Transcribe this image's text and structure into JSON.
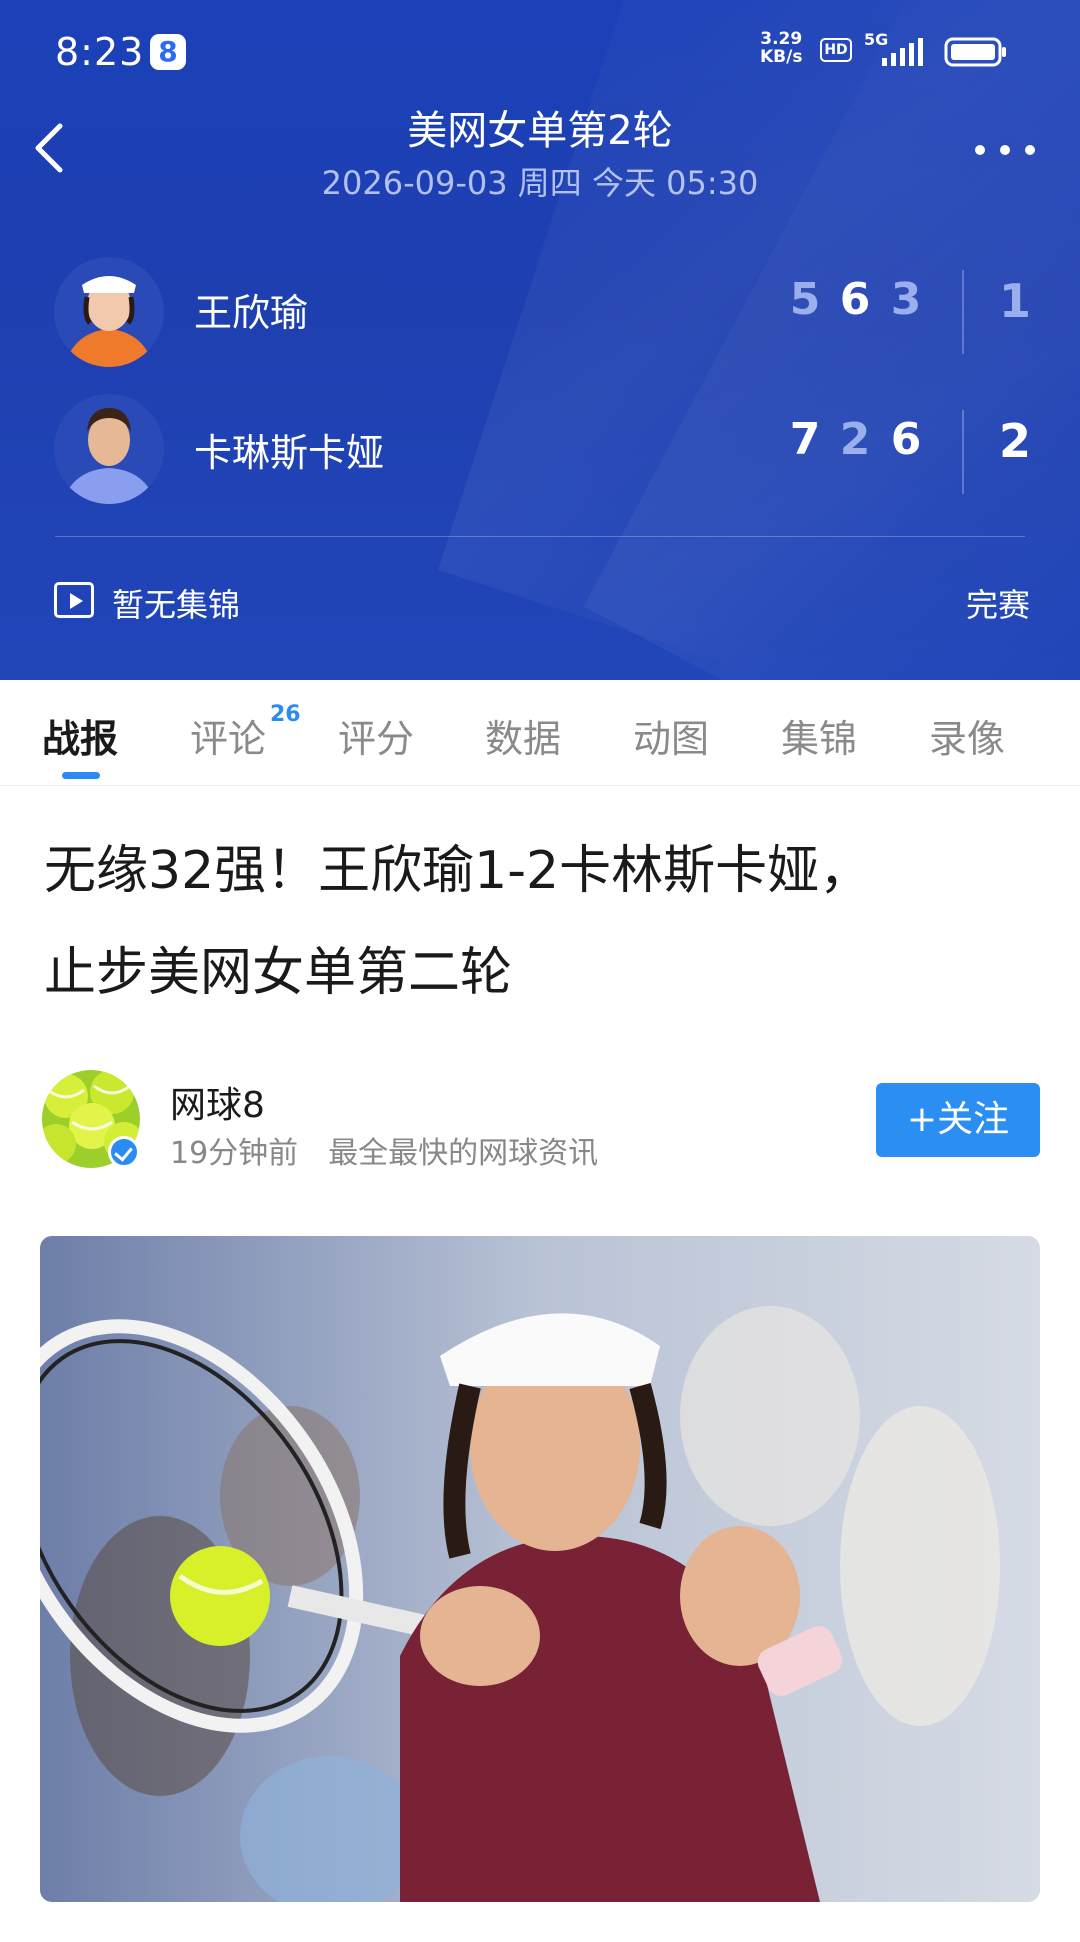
{
  "status_bar": {
    "time": "8:23",
    "app_badge": "8",
    "speed_value": "3.29",
    "speed_unit": "KB/s",
    "hd": "HD",
    "network": "5G"
  },
  "header": {
    "title": "美网女单第2轮",
    "datetime": "2026-09-03 周四 今天 05:30"
  },
  "players": [
    {
      "name": "王欣瑜",
      "sets": [
        "5",
        "6",
        "3"
      ],
      "sets_won": "1"
    },
    {
      "name": "卡琳斯卡娅",
      "sets": [
        "7",
        "2",
        "6"
      ],
      "sets_won": "2"
    }
  ],
  "highlights_label": "暂无集锦",
  "match_status": "完赛",
  "tabs": [
    {
      "label": "战报",
      "active": true
    },
    {
      "label": "评论",
      "badge": "26"
    },
    {
      "label": "评分"
    },
    {
      "label": "数据"
    },
    {
      "label": "动图"
    },
    {
      "label": "集锦"
    },
    {
      "label": "录像"
    }
  ],
  "article": {
    "headline_line1": "无缘32强！王欣瑜1-2卡林斯卡娅，",
    "headline_line2": "止步美网女单第二轮",
    "author": "网球8",
    "posted": "19分钟前",
    "tagline": "最全最快的网球资讯",
    "follow_label": "+关注"
  },
  "colors": {
    "header_blue": "#1e3fb0",
    "accent_blue": "#2a8cf2"
  }
}
